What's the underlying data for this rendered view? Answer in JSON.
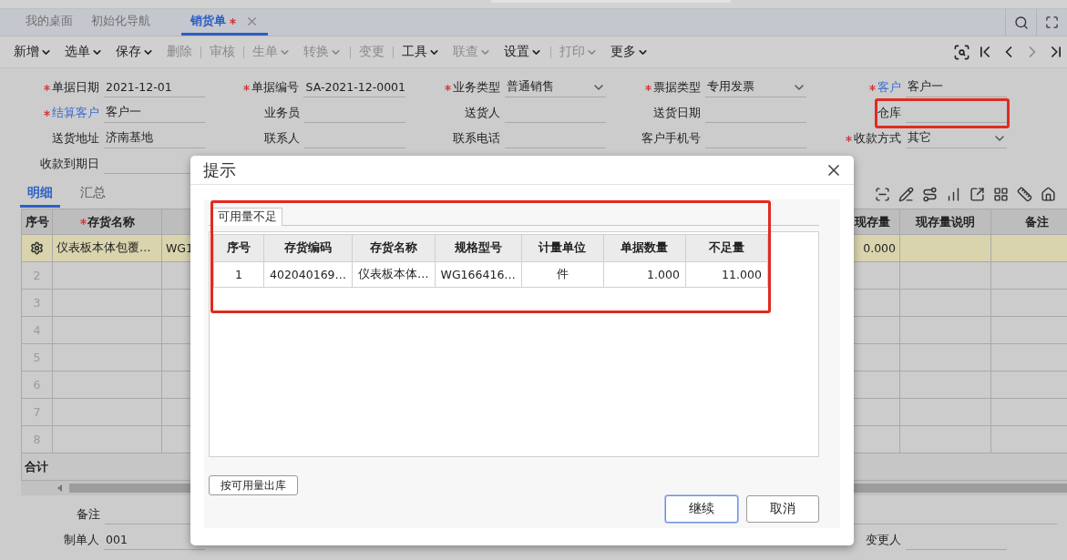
{
  "tabs": [
    {
      "label": "我的桌面",
      "selected": false,
      "modified": false,
      "closable": false
    },
    {
      "label": "初始化导航",
      "selected": false,
      "modified": false,
      "closable": false
    },
    {
      "label": "销货单",
      "selected": true,
      "modified": true,
      "closable": true
    }
  ],
  "toolbar": [
    {
      "label": "新增",
      "menu": true,
      "disabled": false,
      "separator_before": false
    },
    {
      "label": "选单",
      "menu": true,
      "disabled": false,
      "separator_before": false
    },
    {
      "label": "保存",
      "menu": true,
      "disabled": false,
      "separator_before": false
    },
    {
      "label": "删除",
      "menu": false,
      "disabled": true,
      "separator_before": false
    },
    {
      "label": "审核",
      "menu": false,
      "disabled": true,
      "separator_before": true
    },
    {
      "label": "生单",
      "menu": true,
      "disabled": true,
      "separator_before": true
    },
    {
      "label": "转换",
      "menu": true,
      "disabled": true,
      "separator_before": false
    },
    {
      "label": "变更",
      "menu": false,
      "disabled": true,
      "separator_before": true
    },
    {
      "label": "工具",
      "menu": true,
      "disabled": false,
      "separator_before": true
    },
    {
      "label": "联查",
      "menu": true,
      "disabled": true,
      "separator_before": false
    },
    {
      "label": "设置",
      "menu": true,
      "disabled": false,
      "separator_before": false
    },
    {
      "label": "打印",
      "menu": true,
      "disabled": true,
      "separator_before": true
    },
    {
      "label": "更多",
      "menu": true,
      "disabled": false,
      "separator_before": false
    }
  ],
  "nav_buttons": [
    {
      "kind": "preview",
      "disabled": false
    },
    {
      "kind": "first",
      "disabled": false
    },
    {
      "kind": "prev",
      "disabled": false
    },
    {
      "kind": "next",
      "disabled": true
    },
    {
      "kind": "last",
      "disabled": false
    }
  ],
  "form_rows": [
    [
      {
        "label": "单据日期",
        "value": "2021-12-01",
        "required": true,
        "link": false,
        "dropdown": false
      },
      {
        "label": "单据编号",
        "value": "SA-2021-12-0001",
        "required": true,
        "link": false,
        "dropdown": false
      },
      {
        "label": "业务类型",
        "value": "普通销售",
        "required": true,
        "link": false,
        "dropdown": true
      },
      {
        "label": "票据类型",
        "value": "专用发票",
        "required": true,
        "link": false,
        "dropdown": true
      },
      {
        "label": "客户",
        "value": "客户一",
        "required": true,
        "link": true,
        "dropdown": false
      }
    ],
    [
      {
        "label": "结算客户",
        "value": "客户一",
        "required": true,
        "link": true,
        "dropdown": false
      },
      {
        "label": "业务员",
        "required": false,
        "link": false,
        "dropdown": false
      },
      {
        "label": "送货人",
        "required": false,
        "link": false,
        "dropdown": false
      },
      {
        "label": "送货日期",
        "required": false,
        "link": false,
        "dropdown": false
      },
      {
        "label": "仓库",
        "required": false,
        "link": false,
        "dropdown": false,
        "highlighted": true
      }
    ],
    [
      {
        "label": "送货地址",
        "value": "济南基地",
        "required": false,
        "link": false,
        "dropdown": false
      },
      {
        "label": "联系人",
        "required": false,
        "link": false,
        "dropdown": false
      },
      {
        "label": "联系电话",
        "required": false,
        "link": false,
        "dropdown": false
      },
      {
        "label": "客户手机号",
        "required": false,
        "link": false,
        "dropdown": false
      },
      {
        "label": "收款方式",
        "value": "其它",
        "required": true,
        "link": false,
        "dropdown": true
      }
    ],
    [
      {
        "label": "收款到期日",
        "required": false,
        "link": false,
        "dropdown": false
      }
    ]
  ],
  "detail_tabs": [
    {
      "label": "明细",
      "selected": true
    },
    {
      "label": "汇总",
      "selected": false
    }
  ],
  "grid": {
    "columns": [
      {
        "label": "序号",
        "required": false
      },
      {
        "label": "存货名称",
        "required": true
      },
      {
        "required": false
      },
      {
        "label": "现存量",
        "required": false
      },
      {
        "label": "现存量说明",
        "required": false
      },
      {
        "label": "备注",
        "required": false
      }
    ],
    "rows": [
      {
        "kind": "active",
        "cells": [
          "",
          "仪表板本体包覆…",
          "WG1",
          "0.000",
          "",
          ""
        ]
      },
      {
        "kind": "empty",
        "cells": [
          "2",
          "",
          "",
          "",
          "",
          ""
        ]
      },
      {
        "kind": "empty",
        "cells": [
          "3",
          "",
          "",
          "",
          "",
          ""
        ]
      },
      {
        "kind": "empty",
        "cells": [
          "4",
          "",
          "",
          "",
          "",
          ""
        ]
      },
      {
        "kind": "empty",
        "cells": [
          "5",
          "",
          "",
          "",
          "",
          ""
        ]
      },
      {
        "kind": "empty",
        "cells": [
          "6",
          "",
          "",
          "",
          "",
          ""
        ]
      },
      {
        "kind": "empty",
        "cells": [
          "7",
          "",
          "",
          "",
          "",
          ""
        ]
      },
      {
        "kind": "empty",
        "cells": [
          "8",
          "",
          "",
          "",
          "",
          ""
        ]
      }
    ],
    "total_label": "合计"
  },
  "footer_rows": [
    [
      {
        "label": "备注",
        "kind": "wide"
      }
    ],
    [
      {
        "label": "制单人",
        "value": "001",
        "kind": "normal"
      },
      {
        "label": "变更人",
        "kind": "far"
      }
    ]
  ],
  "dialog": {
    "title": "提示",
    "tab": "可用量不足",
    "columns": [
      "序号",
      "存货编码",
      "存货名称",
      "规格型号",
      "计量单位",
      "单据数量",
      "不足量"
    ],
    "rows": [
      [
        "1",
        "402040169…",
        "仪表板本体…",
        "WG166416…",
        "件",
        "1.000",
        "11.000"
      ]
    ],
    "highlighted": true,
    "side_button": "按可用量出库",
    "buttons": [
      {
        "label": "继续",
        "primary": true
      },
      {
        "label": "取消",
        "primary": false
      }
    ]
  }
}
